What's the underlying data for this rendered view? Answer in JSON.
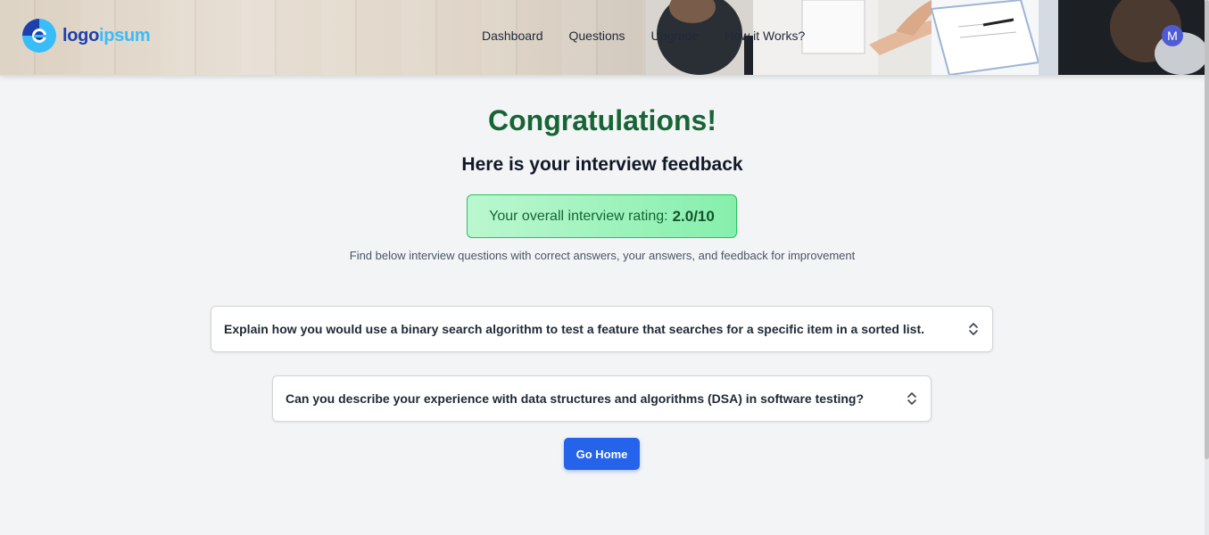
{
  "header": {
    "logo": {
      "part1": "logo",
      "part2": "ipsum"
    },
    "nav": [
      "Dashboard",
      "Questions",
      "Upgrade",
      "How it Works?"
    ],
    "avatar_initial": "M"
  },
  "main": {
    "title": "Congratulations!",
    "subtitle": "Here is your interview feedback",
    "rating_label": "Your overall interview rating:",
    "rating_value": "2.0/10",
    "hint": "Find below interview questions with correct answers, your answers, and feedback for improvement",
    "questions": [
      "Explain how you would use a binary search algorithm to test a feature that searches for a specific item in a sorted list.",
      "Can you describe your experience with data structures and algorithms (DSA) in software testing?"
    ],
    "home_button": "Go Home"
  },
  "colors": {
    "title": "#166534",
    "primary": "#2563eb",
    "rating_bg": "#bbf7d0"
  }
}
